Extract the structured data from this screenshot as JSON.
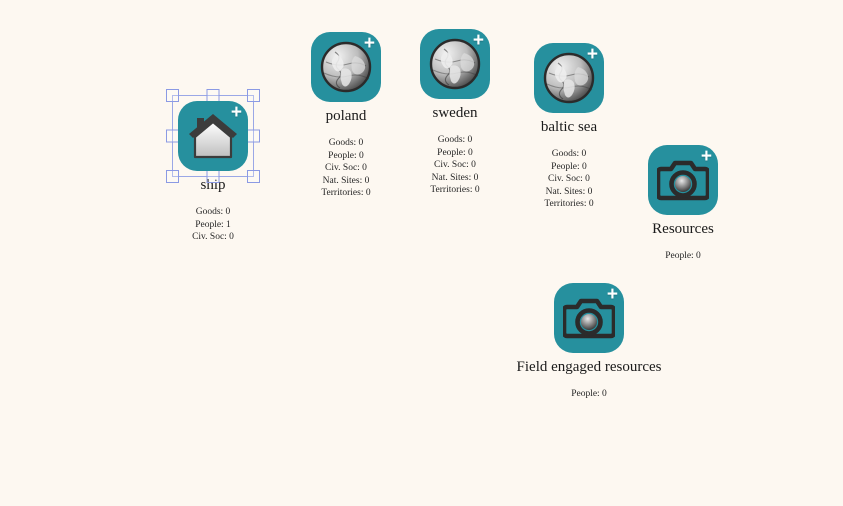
{
  "canvas": {
    "background_color": "#fdf8f1",
    "tile_color": "#26909e",
    "selection_handle_color": "#8b9ae4",
    "badge_symbol": "+"
  },
  "nodes": [
    {
      "id": "ship",
      "label": "ship",
      "icon": "house-icon",
      "selected": true,
      "stats": [
        "Goods: 0",
        "People: 1",
        "Civ. Soc: 0"
      ]
    },
    {
      "id": "poland",
      "label": "poland",
      "icon": "globe-icon",
      "selected": false,
      "stats": [
        "Goods: 0",
        "People: 0",
        "Civ. Soc: 0",
        "Nat. Sites: 0",
        "Territories: 0"
      ]
    },
    {
      "id": "sweden",
      "label": "sweden",
      "icon": "globe-icon",
      "selected": false,
      "stats": [
        "Goods: 0",
        "People: 0",
        "Civ. Soc: 0",
        "Nat. Sites: 0",
        "Territories: 0"
      ]
    },
    {
      "id": "baltic-sea",
      "label": "baltic sea",
      "icon": "globe-icon",
      "selected": false,
      "stats": [
        "Goods: 0",
        "People: 0",
        "Civ. Soc: 0",
        "Nat. Sites: 0",
        "Territories: 0"
      ]
    },
    {
      "id": "resources",
      "label": "Resources",
      "icon": "camera-icon",
      "selected": false,
      "stats": [
        "People: 0"
      ]
    },
    {
      "id": "field-engaged-resources",
      "label": "Field engaged resources",
      "icon": "camera-icon",
      "selected": false,
      "stats": [
        "People: 0"
      ]
    }
  ]
}
